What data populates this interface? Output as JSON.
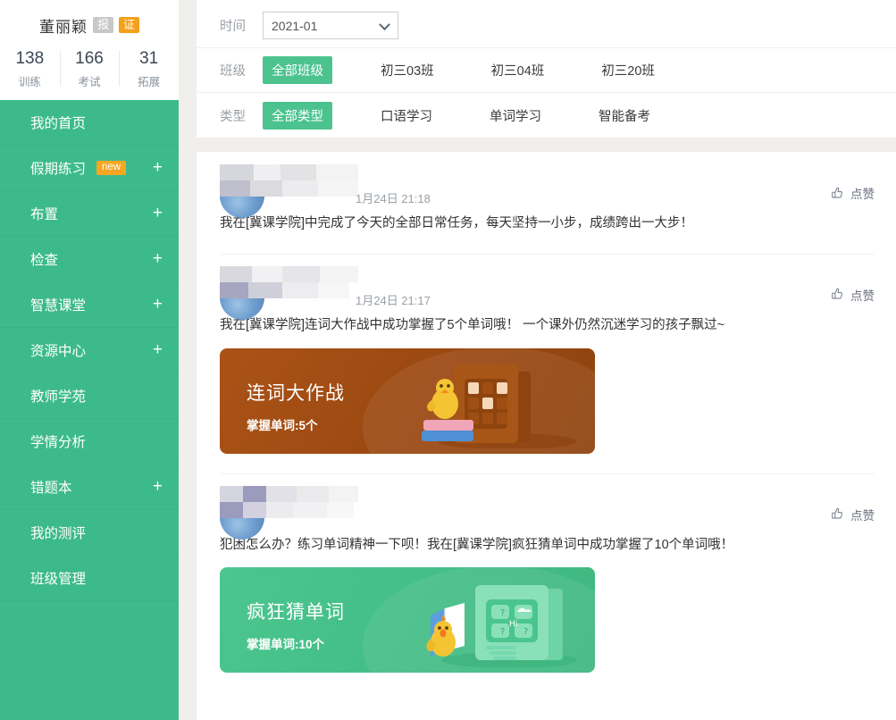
{
  "colors": {
    "sidebar_green": "#3dba8c",
    "accent_green": "#4cc38f",
    "badge_orange": "#f3a01c",
    "badge_gray": "#c8c8c8",
    "page_bg": "#f0efeb",
    "card_orange": "#a04e14",
    "card_green": "#45bf88"
  },
  "profile": {
    "name": "董丽颖",
    "badges": [
      {
        "label": "报",
        "style": "gray"
      },
      {
        "label": "证",
        "style": "orange"
      }
    ],
    "stats": [
      {
        "value": "138",
        "label": "训练"
      },
      {
        "value": "166",
        "label": "考试"
      },
      {
        "value": "31",
        "label": "拓展"
      }
    ]
  },
  "sidebar": {
    "items": [
      {
        "label": "我的首页",
        "new": null,
        "expandable": false
      },
      {
        "label": "假期练习",
        "new": "new",
        "expandable": true
      },
      {
        "label": "布置",
        "new": null,
        "expandable": true
      },
      {
        "label": "检查",
        "new": null,
        "expandable": true
      },
      {
        "label": "智慧课堂",
        "new": null,
        "expandable": true
      },
      {
        "label": "资源中心",
        "new": null,
        "expandable": true
      },
      {
        "label": "教师学苑",
        "new": null,
        "expandable": false
      },
      {
        "label": "学情分析",
        "new": null,
        "expandable": false
      },
      {
        "label": "错题本",
        "new": null,
        "expandable": true
      },
      {
        "label": "我的测评",
        "new": null,
        "expandable": false
      },
      {
        "label": "班级管理",
        "new": null,
        "expandable": false
      }
    ],
    "expand_symbol": "+"
  },
  "filters": {
    "time": {
      "label": "时间",
      "selected": "2021-01",
      "icon": "chevron-down-icon"
    },
    "class": {
      "label": "班级",
      "options": [
        "全部班级",
        "初三03班",
        "初三04班",
        "初三20班"
      ],
      "active_index": 0
    },
    "type": {
      "label": "类型",
      "options": [
        "全部类型",
        "口语学习",
        "单词学习",
        "智能备考"
      ],
      "active_index": 0
    }
  },
  "feed": {
    "like_label": "点赞",
    "like_icon": "thumbs-up-icon",
    "posts": [
      {
        "author": "",
        "time": "1月24日 21:18",
        "text": "我在[冀课学院]中完成了今天的全部日常任务，每天坚持一小步，成绩跨出一大步！",
        "card": null
      },
      {
        "author": "",
        "time": "1月24日 21:17",
        "text": "我在[冀课学院]连词大作战中成功掌握了5个单词哦！ 一个课外仍然沉迷学习的孩子飘过~",
        "card": {
          "title": "连词大作战",
          "subtitle": "掌握单词:5个",
          "theme": "orange",
          "art": "chick-on-books-grid-icon"
        }
      },
      {
        "author": "",
        "time": "",
        "text": "犯困怎么办？练习单词精神一下呗！我在[冀课学院]疯狂猜单词中成功掌握了10个单词哦！",
        "card": {
          "title": "疯狂猜单词",
          "subtitle": "掌握单词:10个",
          "theme": "green",
          "art": "chick-book-screen-icon"
        }
      }
    ]
  }
}
